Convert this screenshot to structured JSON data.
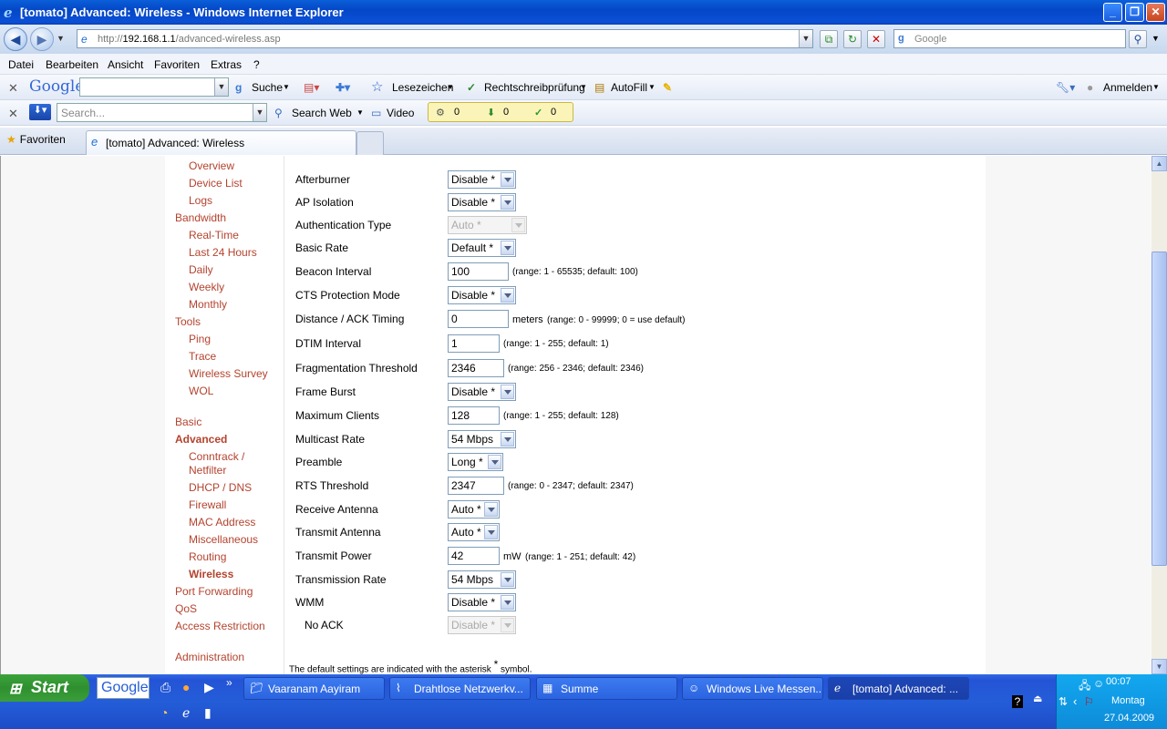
{
  "window": {
    "title": "[tomato] Advanced: Wireless - Windows Internet Explorer"
  },
  "addressbar": {
    "url_prefix": "http://",
    "url_host": "192.168.1.1",
    "url_path": "/advanced-wireless.asp",
    "search_placeholder": "Google"
  },
  "menu": [
    "Datei",
    "Bearbeiten",
    "Ansicht",
    "Favoriten",
    "Extras",
    "?"
  ],
  "google_toolbar": {
    "logo": "Google",
    "suche": "Suche",
    "lesezeichen": "Lesezeichen",
    "spellcheck": "Rechtschreibprüfung",
    "autofill": "AutoFill",
    "signin": "Anmelden"
  },
  "search_toolbar": {
    "placeholder": "Search...",
    "search_web": "Search Web",
    "video": "Video",
    "counter1": "0",
    "counter2": "0",
    "counter3": "0"
  },
  "tabs": {
    "favorites": "Favoriten",
    "active_tab": "[tomato] Advanced: Wireless"
  },
  "sidebar": {
    "items": [
      {
        "label": "Overview",
        "level": "sub"
      },
      {
        "label": "Device List",
        "level": "sub"
      },
      {
        "label": "Logs",
        "level": "sub"
      },
      {
        "label": "Bandwidth",
        "level": "top"
      },
      {
        "label": "Real-Time",
        "level": "sub"
      },
      {
        "label": "Last 24 Hours",
        "level": "sub"
      },
      {
        "label": "Daily",
        "level": "sub"
      },
      {
        "label": "Weekly",
        "level": "sub"
      },
      {
        "label": "Monthly",
        "level": "sub"
      },
      {
        "label": "Tools",
        "level": "top"
      },
      {
        "label": "Ping",
        "level": "sub"
      },
      {
        "label": "Trace",
        "level": "sub"
      },
      {
        "label": "Wireless Survey",
        "level": "sub"
      },
      {
        "label": "WOL",
        "level": "sub"
      },
      {
        "label": "Basic",
        "level": "top"
      },
      {
        "label": "Advanced",
        "level": "top",
        "selected": true
      },
      {
        "label": "Conntrack / Netfilter",
        "level": "sub"
      },
      {
        "label": "DHCP / DNS",
        "level": "sub"
      },
      {
        "label": "Firewall",
        "level": "sub"
      },
      {
        "label": "MAC Address",
        "level": "sub"
      },
      {
        "label": "Miscellaneous",
        "level": "sub"
      },
      {
        "label": "Routing",
        "level": "sub"
      },
      {
        "label": "Wireless",
        "level": "sub",
        "selected": true
      },
      {
        "label": "Port Forwarding",
        "level": "top"
      },
      {
        "label": "QoS",
        "level": "top"
      },
      {
        "label": "Access Restriction",
        "level": "top"
      },
      {
        "label": "Administration",
        "level": "top"
      }
    ]
  },
  "settings": [
    {
      "label": "Afterburner",
      "type": "select",
      "value": "Disable *"
    },
    {
      "label": "AP Isolation",
      "type": "select",
      "value": "Disable *"
    },
    {
      "label": "Authentication Type",
      "type": "select",
      "value": "Auto *",
      "disabled": true
    },
    {
      "label": "Basic Rate",
      "type": "select",
      "value": "Default *"
    },
    {
      "label": "Beacon Interval",
      "type": "input",
      "value": "100",
      "hint": "(range: 1 - 65535; default: 100)"
    },
    {
      "label": "CTS Protection Mode",
      "type": "select",
      "value": "Disable *"
    },
    {
      "label": "Distance / ACK Timing",
      "type": "input",
      "value": "0",
      "unit": "meters",
      "hint": "(range: 0 - 99999; 0 = use default)"
    },
    {
      "label": "DTIM Interval",
      "type": "input",
      "value": "1",
      "hint": "(range: 1 - 255; default: 1)"
    },
    {
      "label": "Fragmentation Threshold",
      "type": "input",
      "value": "2346",
      "hint": "(range: 256 - 2346; default: 2346)"
    },
    {
      "label": "Frame Burst",
      "type": "select",
      "value": "Disable *"
    },
    {
      "label": "Maximum Clients",
      "type": "input",
      "value": "128",
      "hint": "(range: 1 - 255; default: 128)"
    },
    {
      "label": "Multicast Rate",
      "type": "select",
      "value": "54 Mbps"
    },
    {
      "label": "Preamble",
      "type": "select",
      "value": "Long *"
    },
    {
      "label": "RTS Threshold",
      "type": "input",
      "value": "2347",
      "hint": "(range: 0 - 2347; default: 2347)"
    },
    {
      "label": "Receive Antenna",
      "type": "select",
      "value": "Auto *"
    },
    {
      "label": "Transmit Antenna",
      "type": "select",
      "value": "Auto *"
    },
    {
      "label": "Transmit Power",
      "type": "input",
      "value": "42",
      "unit": "mW",
      "hint": "(range: 1 - 251; default: 42)"
    },
    {
      "label": "Transmission Rate",
      "type": "select",
      "value": "54 Mbps"
    },
    {
      "label": "WMM",
      "type": "select",
      "value": "Disable *"
    },
    {
      "label": "No ACK",
      "type": "select",
      "value": "Disable *",
      "disabled": true
    }
  ],
  "footnote": {
    "before": "The default settings are indicated with the asterisk",
    "star": "*",
    "after": "symbol."
  },
  "taskbar": {
    "start": "Start",
    "google": "Google",
    "tasks": [
      "Vaaranam Aayiram",
      "Drahtlose Netzwerkv...",
      "Summe",
      "Windows Live Messen...",
      "[tomato] Advanced: ..."
    ],
    "time": "00:07",
    "day": "Montag",
    "date": "27.04.2009"
  }
}
